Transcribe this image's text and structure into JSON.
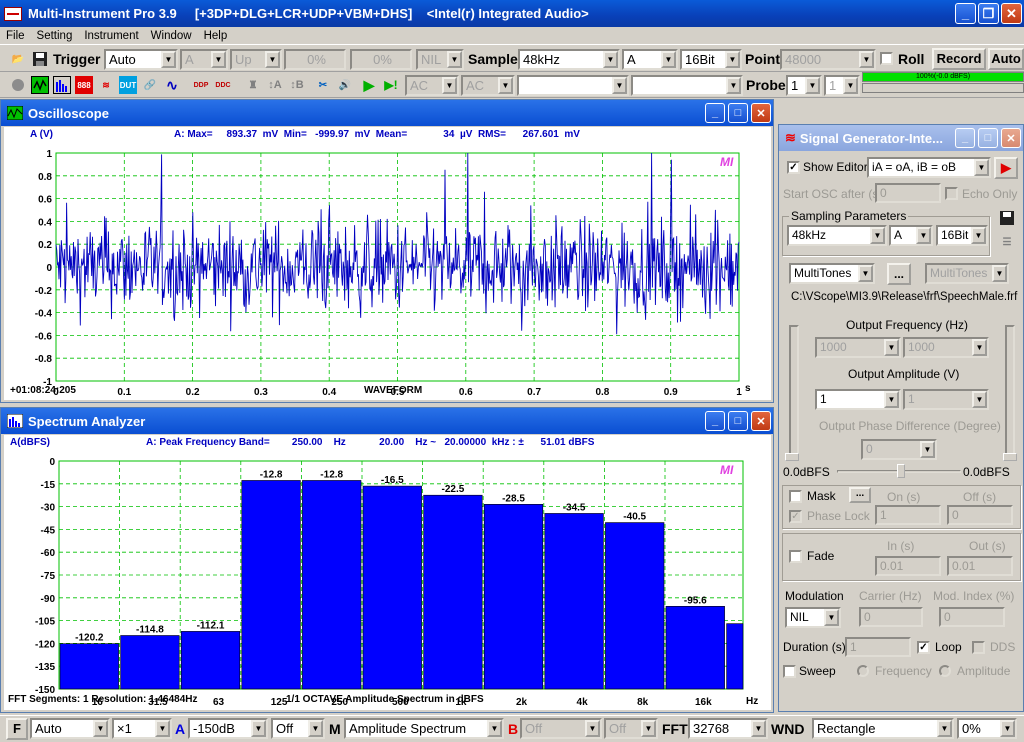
{
  "app": {
    "title": "Multi-Instrument Pro 3.9     [+3DP+DLG+LCR+UDP+VBM+DHS]    <Intel(r) Integrated Audio>"
  },
  "menu": [
    "File",
    "Setting",
    "Instrument",
    "Window",
    "Help"
  ],
  "toolbar1": {
    "trigger_label": "Trigger",
    "trigger_mode": "Auto",
    "trigger_channel": "A",
    "trigger_edge": "Up",
    "trigger_level": "0%",
    "trigger_delay": "0%",
    "trigger_source": "NIL",
    "sample_label": "Sample",
    "sample_rate": "48kHz",
    "channel": "A",
    "bits": "16Bit",
    "point_label": "Point",
    "points": "48000",
    "roll_label": "Roll",
    "record_label": "Record",
    "auto_label": "Auto"
  },
  "toolbar2": {
    "coupling_a": "AC",
    "coupling_b": "AC",
    "probe_label": "Probe",
    "probe_a": "1",
    "probe_b": "1",
    "level_meter": "100%(-0.0 dBFS)",
    "level_percent": 100
  },
  "oscilloscope": {
    "title": "Oscilloscope",
    "channel_label": "A (V)",
    "stats": "A: Max=     893.37  mV  Min=   -999.97  mV  Mean=             34  µV  RMS=      267.601  mV",
    "timestamp": "+01:08:24:205",
    "xlabel": "WAVEFORM",
    "xunit": "s",
    "yticks": [
      "1",
      "0.8",
      "0.6",
      "0.4",
      "0.2",
      "0",
      "-0.2",
      "-0.4",
      "-0.6",
      "-0.8",
      "-1"
    ],
    "xticks": [
      "0",
      "0.1",
      "0.2",
      "0.3",
      "0.4",
      "0.5",
      "0.6",
      "0.7",
      "0.8",
      "0.9",
      "1"
    ],
    "logo": "MI"
  },
  "spectrum": {
    "title": "Spectrum Analyzer",
    "channel_label": "A(dBFS)",
    "stats": "A: Peak Frequency Band=        250.00    Hz            20.00    Hz ~   20.00000  kHz : ±      51.01 dBFS",
    "yticks": [
      "0",
      "-15",
      "-30",
      "-45",
      "-60",
      "-75",
      "-90",
      "-105",
      "-120",
      "-135",
      "-150"
    ],
    "footer_left": "FFT Segments: 1   Resolution: 1.46484Hz",
    "footer_center": "1/1 OCTAVE Amplitude Spectrum in dBFS",
    "xunit": "Hz",
    "logo": "MI"
  },
  "chart_data": {
    "type": "bar",
    "categories": [
      "16",
      "31.5",
      "63",
      "125",
      "250",
      "500",
      "1k",
      "2k",
      "4k",
      "8k",
      "16k"
    ],
    "values": [
      -120.2,
      -114.8,
      -112.1,
      -12.8,
      -12.8,
      -16.5,
      -22.5,
      -28.5,
      -34.5,
      -40.5,
      -95.6
    ],
    "ylabel": "A(dBFS)",
    "xlabel": "1/1 OCTAVE Amplitude Spectrum in dBFS",
    "ylim": [
      -150,
      0
    ],
    "grid": true,
    "bar_color": "#0000ff"
  },
  "signal_generator": {
    "title": "Signal Generator-Inte...",
    "show_editor": "Show Editor",
    "editor_expr": "iA = oA, iB = oB",
    "start_osc": "Start OSC after (s)",
    "start_osc_val": "0",
    "echo_only": "Echo Only",
    "sampling_params": "Sampling Parameters",
    "sample_rate": "48kHz",
    "channel": "A",
    "bits": "16Bit",
    "waveform": "MultiTones",
    "waveform2": "MultiTones",
    "ellipsis": "...",
    "file_path": "C:\\VScope\\MI3.9\\Release\\frf\\SpeechMale.frf",
    "out_freq": "Output Frequency (Hz)",
    "freq1": "1000",
    "freq2": "1000",
    "out_amp": "Output Amplitude (V)",
    "amp1": "1",
    "amp2": "1",
    "out_phase": "Output Phase Difference (Degree)",
    "phase": "0",
    "bal_left": "0.0dBFS",
    "bal_right": "0.0dBFS",
    "mask": "Mask",
    "mask_btn": "...",
    "on_s": "On (s)",
    "off_s": "Off (s)",
    "phase_lock": "Phase Lock",
    "pl_on": "1",
    "pl_off": "0",
    "fade": "Fade",
    "in_s": "In (s)",
    "out_s": "Out (s)",
    "fade_in": "0.01",
    "fade_out": "0.01",
    "modulation": "Modulation",
    "carrier": "Carrier (Hz)",
    "mod_index": "Mod. Index (%)",
    "mod_type": "NIL",
    "carrier_val": "0",
    "mod_val": "0",
    "duration": "Duration (s)",
    "duration_val": "1",
    "loop": "Loop",
    "dds": "DDS",
    "sweep": "Sweep",
    "sweep_freq": "Frequency",
    "sweep_amp": "Amplitude"
  },
  "statusbar": {
    "f_label": "F",
    "auto": "Auto",
    "mult": "×1",
    "a_label": "A",
    "range": "-150dB",
    "off1": "Off",
    "m_label": "M",
    "mode": "Amplitude Spectrum",
    "b_label": "B",
    "off2": "Off",
    "off3": "Off",
    "fft_label": "FFT",
    "fft_size": "32768",
    "wnd_label": "WND",
    "window": "Rectangle",
    "overlap": "0%"
  }
}
